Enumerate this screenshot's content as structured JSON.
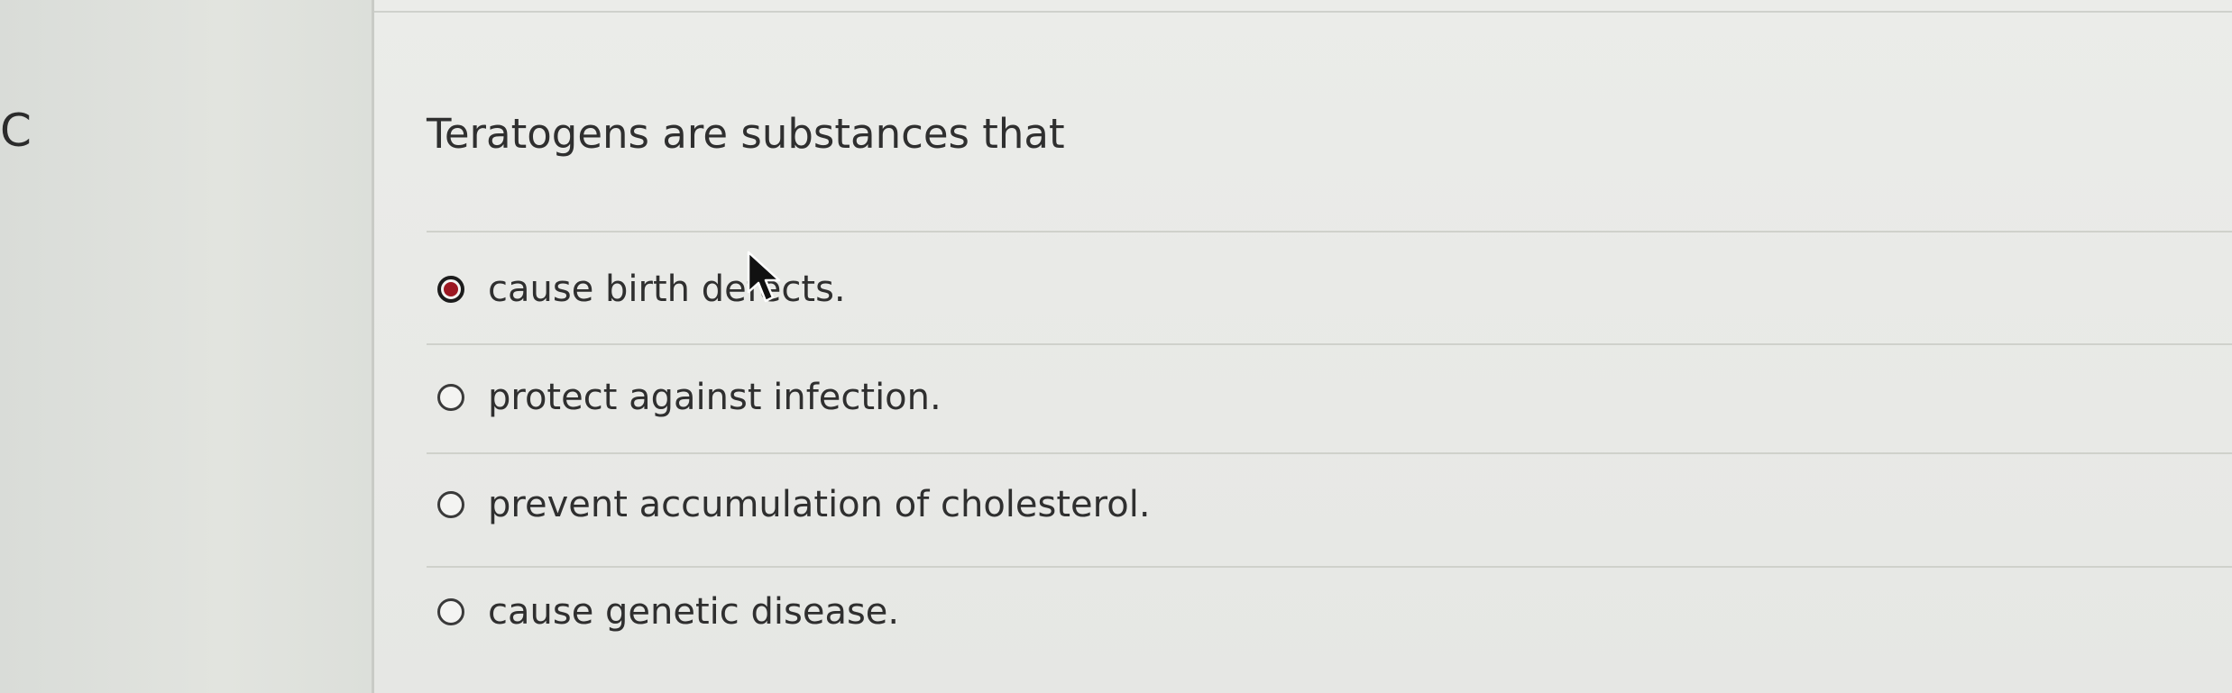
{
  "sidebar": {
    "letter": "C"
  },
  "question": {
    "text": "Teratogens are substances that"
  },
  "options": [
    {
      "label": "cause birth defects.",
      "selected": true
    },
    {
      "label": "protect against infection.",
      "selected": false
    },
    {
      "label": "prevent accumulation of cholesterol.",
      "selected": false
    },
    {
      "label": "cause genetic disease.",
      "selected": false
    }
  ],
  "colors": {
    "selected_radio_fill": "#9c1822",
    "text": "#2f2f2f",
    "background": "#e6e7e4"
  }
}
